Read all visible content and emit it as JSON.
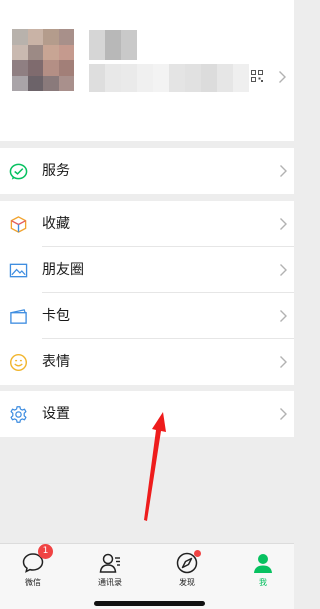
{
  "menu": {
    "services": "服务",
    "favorites": "收藏",
    "moments": "朋友圈",
    "cards": "卡包",
    "stickers": "表情",
    "settings": "设置"
  },
  "tabbar": {
    "chats": {
      "label": "微信",
      "badge": "1"
    },
    "contacts": {
      "label": "通讯录"
    },
    "discover": {
      "label": "发现"
    },
    "me": {
      "label": "我"
    }
  },
  "colors": {
    "accent": "#07c160",
    "badge": "#f04343",
    "background": "#ededed",
    "annotation_arrow": "#ee1c1c"
  },
  "icons": {
    "services": "wechat-pay-icon",
    "favorites": "cube-icon",
    "moments": "photo-icon",
    "cards": "wallet-icon",
    "stickers": "smiley-icon",
    "settings": "gear-icon"
  }
}
